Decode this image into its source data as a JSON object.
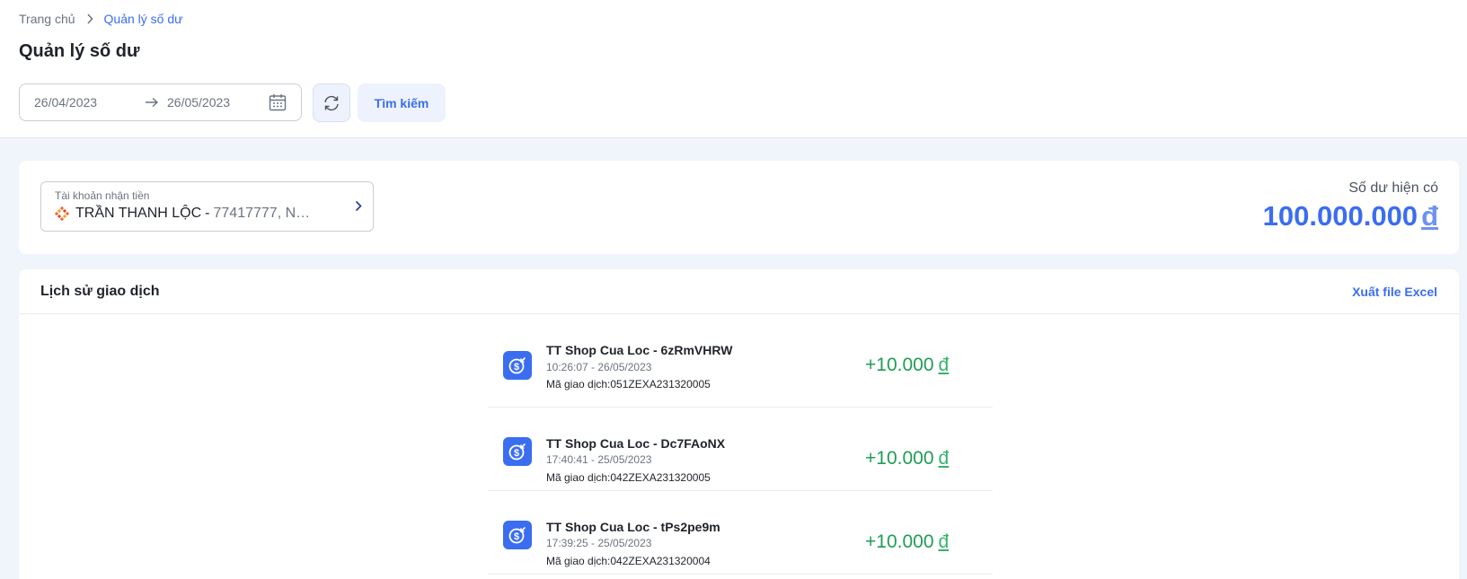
{
  "breadcrumb": {
    "home": "Trang chủ",
    "current": "Quản lý số dư"
  },
  "page_title": "Quản lý số dư",
  "filters": {
    "date_from": "26/04/2023",
    "date_to": "26/05/2023",
    "search_label": "Tìm kiếm"
  },
  "account": {
    "caption": "Tài khoản nhận tiền",
    "name": "TRẦN THANH LỘC",
    "separator": "-",
    "detail": "77417777, NGÂ..."
  },
  "balance": {
    "label": "Số dư hiện có",
    "amount": "100.000.000",
    "currency": "đ"
  },
  "history": {
    "title": "Lịch sử giao dịch",
    "export_label": "Xuất file Excel",
    "transactions": [
      {
        "title": "TT Shop Cua Loc - 6zRmVHRW",
        "time": "10:26:07 - 26/05/2023",
        "code": "Mã giao dịch:051ZEXA231320005",
        "amount": "+10.000",
        "currency": "đ"
      },
      {
        "title": "TT Shop Cua Loc - Dc7FAoNX",
        "time": "17:40:41 - 25/05/2023",
        "code": "Mã giao dịch:042ZEXA231320005",
        "amount": "+10.000",
        "currency": "đ"
      },
      {
        "title": "TT Shop Cua Loc - tPs2pe9m",
        "time": "17:39:25 - 25/05/2023",
        "code": "Mã giao dịch:042ZEXA231320004",
        "amount": "+10.000",
        "currency": "đ"
      }
    ]
  },
  "colors": {
    "accent": "#3a6df0",
    "positive": "#1f9d55",
    "background": "#f0f4fb"
  }
}
